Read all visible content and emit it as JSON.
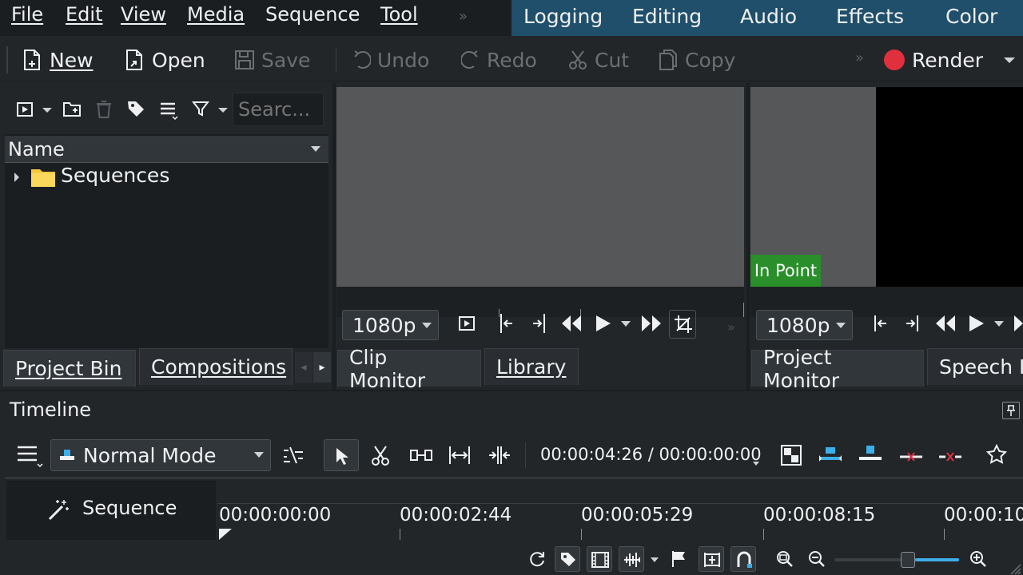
{
  "menu": {
    "items": [
      "File",
      "Edit",
      "View",
      "Media",
      "Sequence",
      "Tool"
    ],
    "overflow": "»"
  },
  "layouts": [
    "Logging",
    "Editing",
    "Audio",
    "Effects",
    "Color"
  ],
  "toolbar": {
    "new": "New",
    "open": "Open",
    "save": "Save",
    "undo": "Undo",
    "redo": "Redo",
    "cut": "Cut",
    "copy": "Copy",
    "overflow": "»",
    "render": "Render",
    "render_color": "#e0303e"
  },
  "project_bin": {
    "search_placeholder": "Searc...",
    "column_name": "Name",
    "folder_label": "Sequences",
    "tabs": [
      "Project Bin",
      "Compositions"
    ]
  },
  "clip_monitor": {
    "resolution": "1080p",
    "tabs": [
      "Clip Monitor",
      "Library"
    ]
  },
  "project_monitor": {
    "in_point": "In Point",
    "resolution": "1080p",
    "tabs": [
      "Project Monitor",
      "Speech I"
    ]
  },
  "timeline": {
    "title": "Timeline",
    "mode": "Normal Mode",
    "timecode": "00:00:04:26 / 00:00:00:00",
    "sequence_label": "Sequence",
    "ruler": [
      "00:00:00:00",
      "00:00:02:44",
      "00:00:05:29",
      "00:00:08:15",
      "00:00:10"
    ],
    "zoom_level": 0.6
  }
}
